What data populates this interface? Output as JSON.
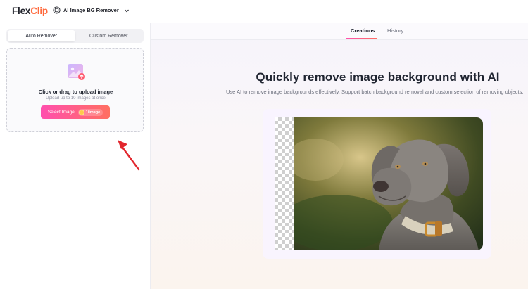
{
  "header": {
    "logo_prefix": "Flex",
    "logo_suffix": "Clip",
    "tool_name": "AI Image BG Remover"
  },
  "sidebar": {
    "modes": [
      "Auto Remover",
      "Custom Remover"
    ],
    "active_mode": "Auto Remover",
    "upload": {
      "title": "Click or drag to upload image",
      "subtitle": "Upload up to 10 images at once",
      "button_label": "Select Image",
      "credit_label": "1/image"
    }
  },
  "main": {
    "tabs": [
      "Creations",
      "History"
    ],
    "active_tab": "Creations",
    "headline": "Quickly remove image background with AI",
    "subline": "Use AI to remove image backgrounds effectively. Support batch background removal and custom selection of removing objects."
  },
  "colors": {
    "brand_accent": "#ff6a3d",
    "button_gradient_start": "#ff4fae",
    "button_gradient_end": "#ff6f61",
    "annotation_arrow": "#e2262d"
  }
}
